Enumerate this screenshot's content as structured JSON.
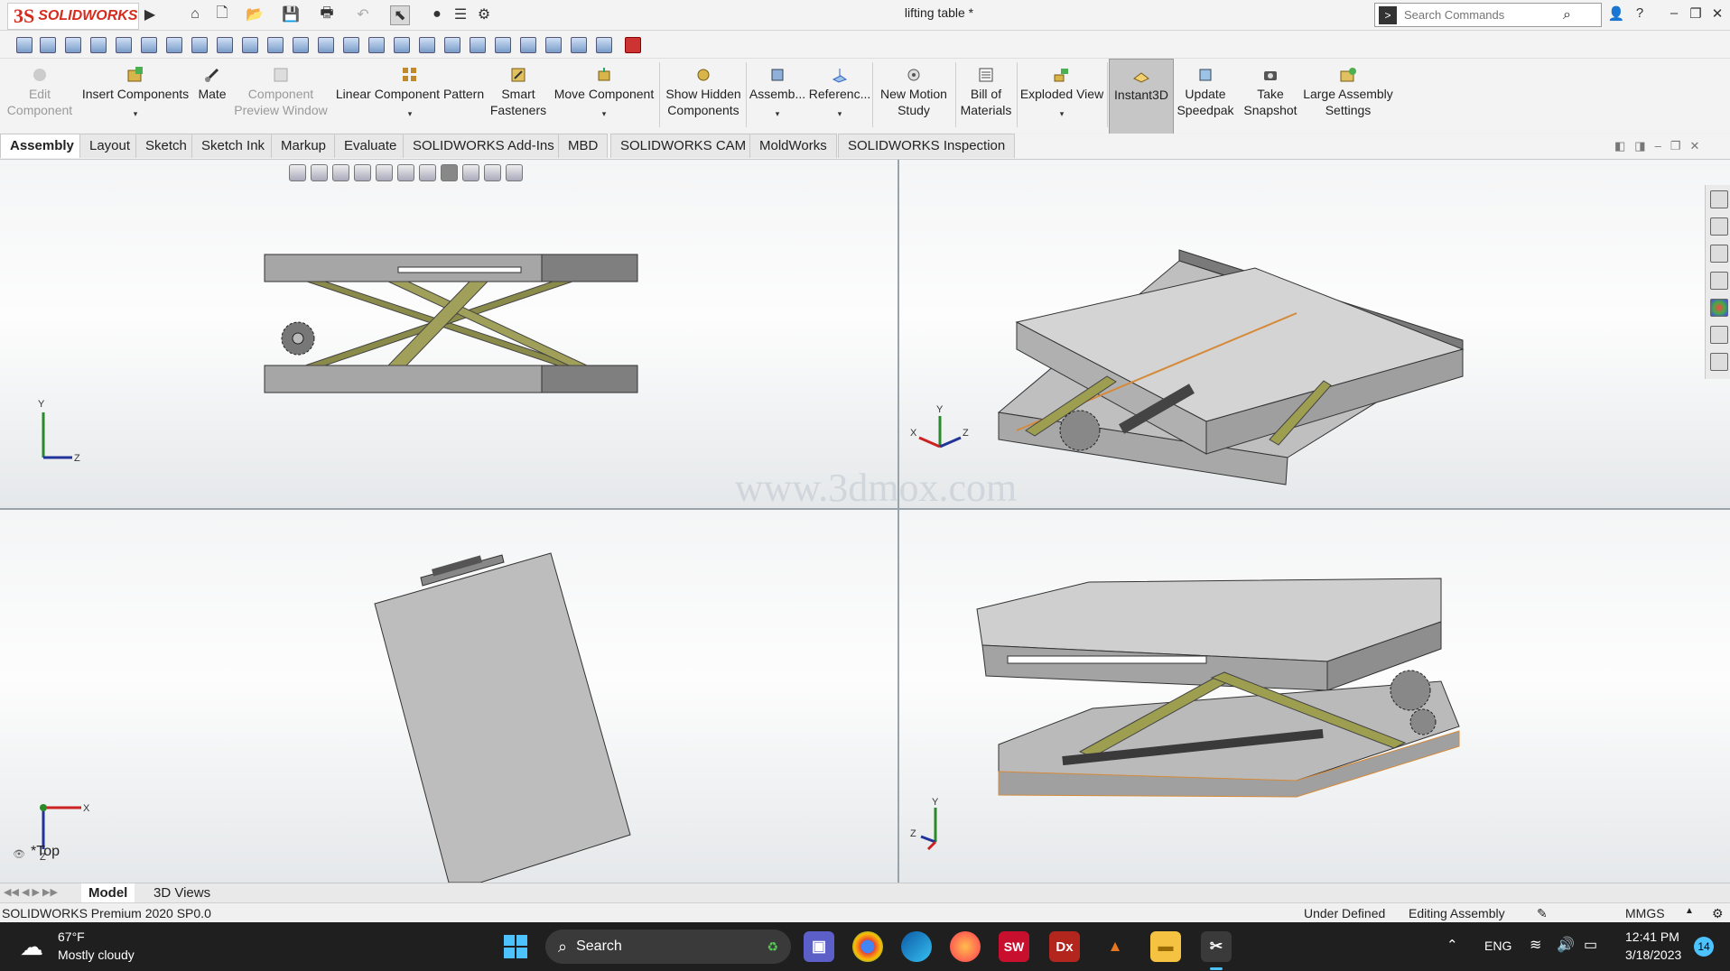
{
  "app": {
    "brand_ds": "3S",
    "brand_name": "SOLIDWORKS",
    "document_title": "lifting table *",
    "search_placeholder": "Search Commands",
    "help_label": "?"
  },
  "command_manager": {
    "items": [
      {
        "line1": "Edit",
        "line2": "Component",
        "enabled": false,
        "icon": "edit-component-icon"
      },
      {
        "line1": "Insert Components",
        "line2": "",
        "enabled": true,
        "icon": "insert-components-icon",
        "dropdown": true
      },
      {
        "line1": "Mate",
        "line2": "",
        "enabled": true,
        "icon": "mate-icon"
      },
      {
        "line1": "Component",
        "line2": "Preview Window",
        "enabled": false,
        "icon": "preview-window-icon"
      },
      {
        "line1": "Linear Component Pattern",
        "line2": "",
        "enabled": true,
        "icon": "linear-pattern-icon",
        "dropdown": true
      },
      {
        "line1": "Smart",
        "line2": "Fasteners",
        "enabled": true,
        "icon": "smart-fasteners-icon"
      },
      {
        "line1": "Move Component",
        "line2": "",
        "enabled": true,
        "icon": "move-component-icon",
        "dropdown": true
      },
      {
        "line1": "Show Hidden",
        "line2": "Components",
        "enabled": true,
        "icon": "show-hidden-icon"
      },
      {
        "line1": "Assemb...",
        "line2": "",
        "enabled": true,
        "icon": "assembly-features-icon",
        "dropdown": true
      },
      {
        "line1": "Referenc...",
        "line2": "",
        "enabled": true,
        "icon": "reference-geometry-icon",
        "dropdown": true
      },
      {
        "line1": "New Motion",
        "line2": "Study",
        "enabled": true,
        "icon": "motion-study-icon"
      },
      {
        "line1": "Bill of",
        "line2": "Materials",
        "enabled": true,
        "icon": "bill-of-materials-icon"
      },
      {
        "line1": "Exploded View",
        "line2": "",
        "enabled": true,
        "icon": "exploded-view-icon",
        "dropdown": true
      },
      {
        "line1": "Instant3D",
        "line2": "",
        "enabled": true,
        "icon": "instant3d-icon",
        "active": true
      },
      {
        "line1": "Update",
        "line2": "Speedpak",
        "enabled": true,
        "icon": "speedpak-icon"
      },
      {
        "line1": "Take",
        "line2": "Snapshot",
        "enabled": true,
        "icon": "snapshot-icon"
      },
      {
        "line1": "Large Assembly",
        "line2": "Settings",
        "enabled": true,
        "icon": "large-assembly-icon"
      }
    ]
  },
  "tabs": [
    "Assembly",
    "Layout",
    "Sketch",
    "Sketch Ink",
    "Markup",
    "Evaluate",
    "SOLIDWORKS Add-Ins",
    "MBD",
    "SOLIDWORKS CAM",
    "MoldWorks",
    "SOLIDWORKS Inspection"
  ],
  "active_tab": "Assembly",
  "viewport": {
    "watermark": "www.3dmox.com",
    "view_label": "*Top",
    "axes": {
      "x": "X",
      "y": "Y",
      "z": "Z"
    }
  },
  "bottom_tabs": [
    "Model",
    "3D Views"
  ],
  "status": {
    "product": "SOLIDWORKS Premium 2020 SP0.0",
    "definition": "Under Defined",
    "mode": "Editing Assembly",
    "units": "MMGS"
  },
  "taskbar": {
    "weather_temp": "67°F",
    "weather_desc": "Mostly cloudy",
    "search_label": "Search",
    "language": "ENG",
    "time": "12:41 PM",
    "date": "3/18/2023",
    "notification_count": "14",
    "sw_badge": "SW",
    "dx_badge": "Dx"
  }
}
